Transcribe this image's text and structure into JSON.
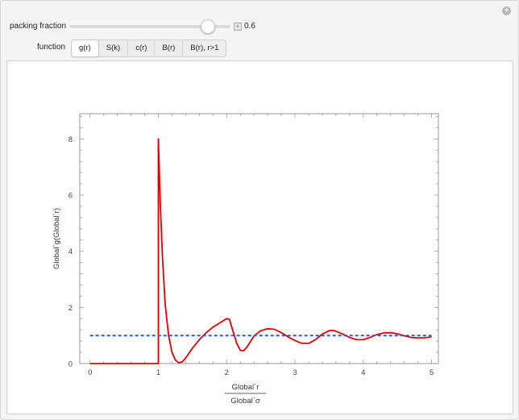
{
  "controls": {
    "packing_fraction": {
      "label": "packing fraction",
      "value": "0.6",
      "min": 0,
      "max": 0.7,
      "position": 0.6
    },
    "function": {
      "label": "function",
      "options": [
        "g(r)",
        "S(k)",
        "c(r)",
        "B(r)",
        "B(r), r>1"
      ],
      "selected": 0
    }
  },
  "colors": {
    "curve": "#e00000",
    "reference": "#1f5fe0",
    "frame": "#999999"
  },
  "chart_data": {
    "type": "line",
    "ylabel": "Global`g(Global`r)",
    "xlabel_numerator": "Global`r",
    "xlabel_denominator": "Global`σ",
    "xlim": [
      -0.15,
      5.1
    ],
    "ylim": [
      0,
      8.9
    ],
    "xticks": [
      0,
      1,
      2,
      3,
      4,
      5
    ],
    "yticks": [
      0,
      2,
      4,
      6,
      8
    ],
    "series": [
      {
        "style": "solid",
        "x": [
          0,
          1.0,
          1.0,
          1.03,
          1.06,
          1.1,
          1.15,
          1.2,
          1.25,
          1.3,
          1.35,
          1.4,
          1.5,
          1.6,
          1.7,
          1.8,
          1.9,
          2.0,
          2.04,
          2.1,
          2.15,
          2.2,
          2.25,
          2.3,
          2.4,
          2.5,
          2.6,
          2.7,
          2.8,
          2.9,
          3.0,
          3.1,
          3.2,
          3.3,
          3.4,
          3.5,
          3.55,
          3.6,
          3.7,
          3.8,
          3.9,
          4.0,
          4.1,
          4.2,
          4.3,
          4.4,
          4.5,
          4.6,
          4.7,
          4.8,
          4.9,
          5.0
        ],
        "y": [
          0,
          0,
          8.0,
          5.6,
          3.8,
          2.1,
          1.0,
          0.4,
          0.12,
          0.03,
          0.06,
          0.2,
          0.55,
          0.85,
          1.1,
          1.3,
          1.45,
          1.6,
          1.58,
          1.1,
          0.7,
          0.47,
          0.46,
          0.6,
          0.98,
          1.17,
          1.24,
          1.22,
          1.1,
          0.95,
          0.82,
          0.72,
          0.72,
          0.85,
          1.05,
          1.17,
          1.18,
          1.15,
          1.05,
          0.93,
          0.85,
          0.85,
          0.93,
          1.03,
          1.09,
          1.1,
          1.06,
          0.99,
          0.93,
          0.91,
          0.92,
          0.95
        ]
      },
      {
        "style": "dashed",
        "x": [
          0,
          5
        ],
        "y": [
          1.0,
          1.0
        ]
      }
    ]
  }
}
